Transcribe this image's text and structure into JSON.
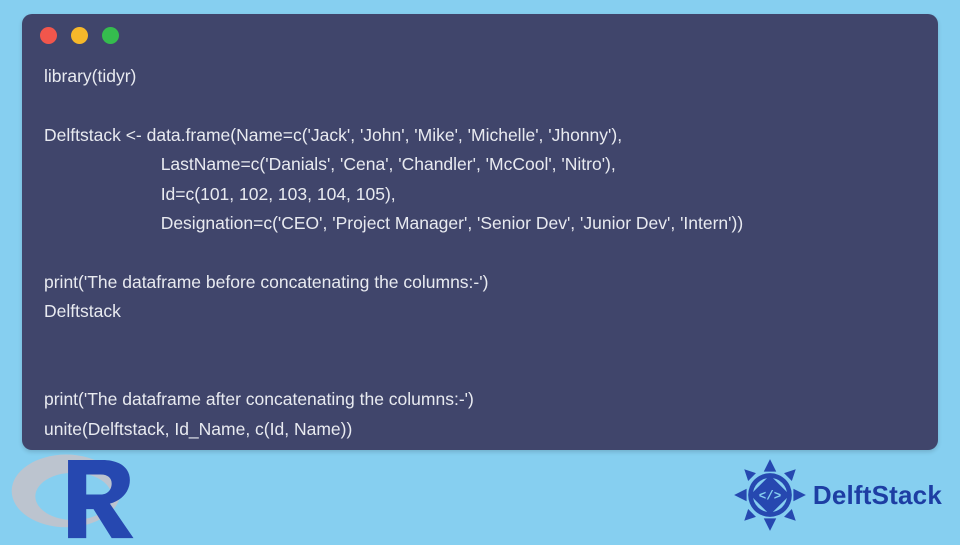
{
  "code": {
    "lines": [
      "library(tidyr)",
      "",
      "Delftstack <- data.frame(Name=c('Jack', 'John', 'Mike', 'Michelle', 'Jhonny'),",
      "                        LastName=c('Danials', 'Cena', 'Chandler', 'McCool', 'Nitro'),",
      "                        Id=c(101, 102, 103, 104, 105),",
      "                        Designation=c('CEO', 'Project Manager', 'Senior Dev', 'Junior Dev', 'Intern'))",
      "",
      "print('The dataframe before concatenating the columns:-')",
      "Delftstack",
      "",
      "",
      "print('The dataframe after concatenating the columns:-')",
      "unite(Delftstack, Id_Name, c(Id, Name))"
    ]
  },
  "brand": {
    "name": "DelftStack"
  }
}
